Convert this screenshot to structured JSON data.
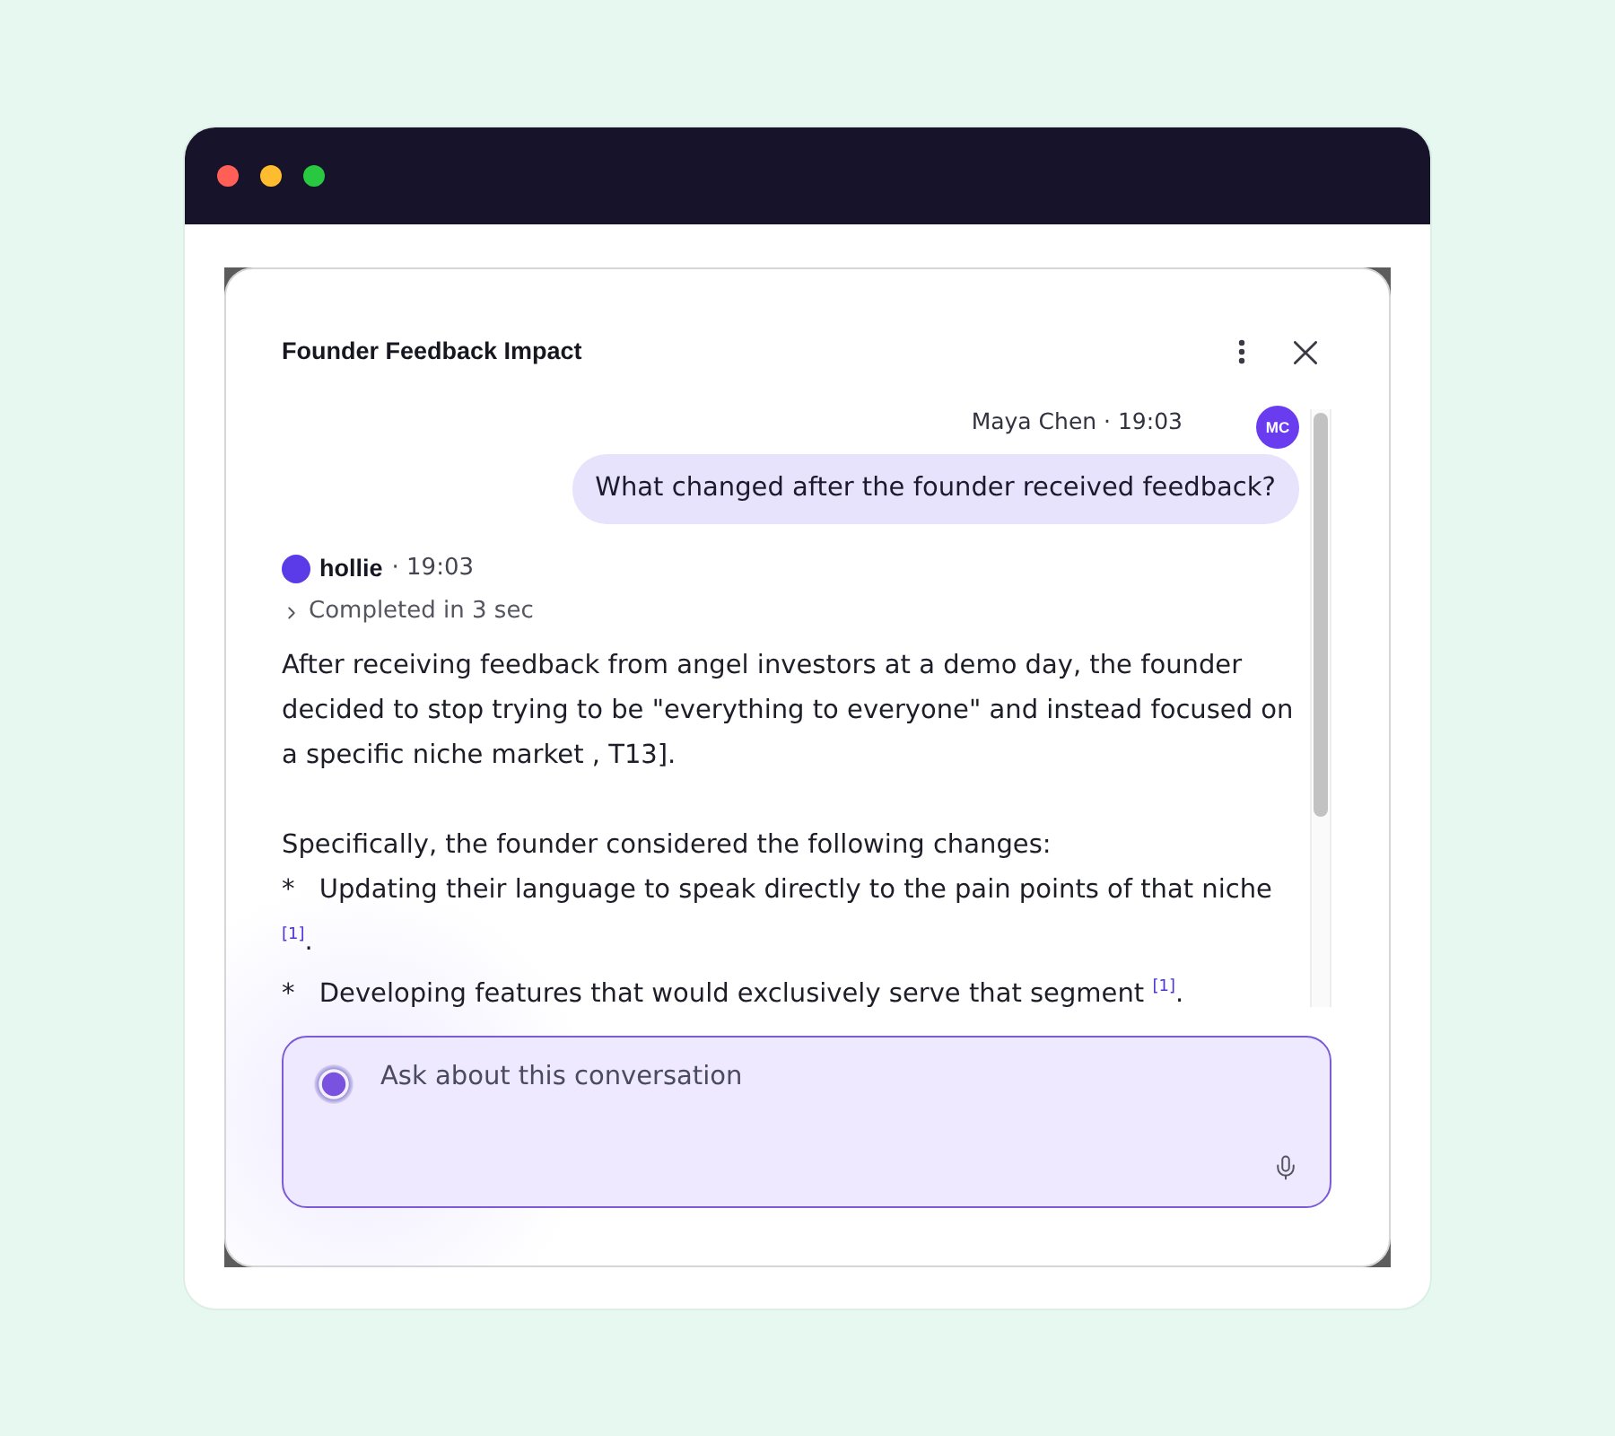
{
  "window": {
    "controls": [
      {
        "color": "#ff5f57"
      },
      {
        "color": "#febc2e"
      },
      {
        "color": "#28c840"
      }
    ]
  },
  "dialog": {
    "title": "Founder Feedback Impact"
  },
  "messages": [
    {
      "kind": "user",
      "author": "Maya Chen",
      "separator": "·",
      "time": "19:03",
      "avatar": "MC",
      "text": "What changed after the founder received feedback?"
    },
    {
      "kind": "assistant",
      "author": "hollie",
      "separator": "·",
      "time": "19:03",
      "status": {
        "label": "Completed in 3 sec",
        "expanded": false
      },
      "answer": {
        "paragraph": "After receiving feedback from angel investors at a demo day, the founder decided to stop trying to be \"everything to everyone\" and instead focused on a specific niche market , T13].",
        "list": {
          "intro": "Specifically, the founder considered the following changes:",
          "items": [
            {
              "marker": "*",
              "text": "Updating their language to speak directly to the pain points of that niche",
              "citation": "[1]",
              "end": "."
            },
            {
              "marker": "*",
              "text": "Developing features that would exclusively serve that segment",
              "citation": "[1]",
              "end": "."
            }
          ]
        }
      }
    }
  ],
  "composer": {
    "placeholder": "Ask about this conversation"
  }
}
